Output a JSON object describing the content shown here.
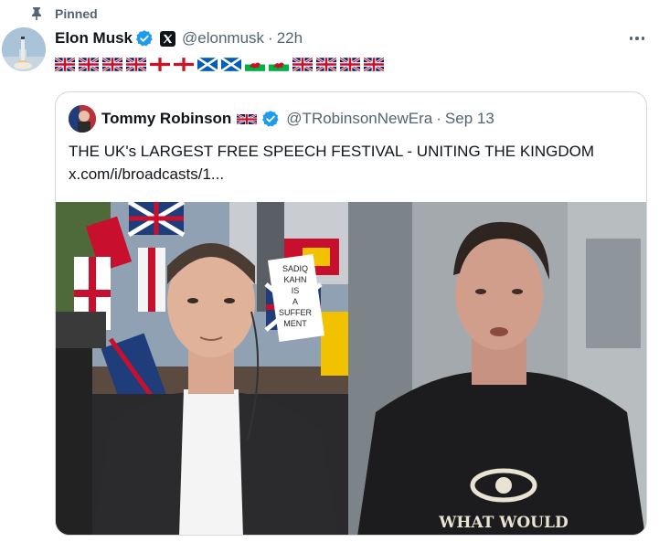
{
  "pinned": {
    "label": "Pinned"
  },
  "post": {
    "author_name": "Elon Musk",
    "handle": "@elonmusk",
    "separator": "·",
    "time": "22h",
    "flags": [
      "flag-uk",
      "flag-uk",
      "flag-uk",
      "flag-uk",
      "flag-england",
      "flag-england",
      "flag-scotland",
      "flag-scotland",
      "flag-wales",
      "flag-wales",
      "flag-uk",
      "flag-uk",
      "flag-uk",
      "flag-uk"
    ]
  },
  "quote": {
    "author_name": "Tommy Robinson",
    "handle": "@TRobinsonNewEra",
    "separator": "·",
    "date": "Sep 13",
    "text_line1": "THE UK's LARGEST FREE SPEECH FESTIVAL - UNITING THE KINGDOM",
    "text_line2": "x.com/i/broadcasts/1..."
  },
  "media": {
    "sign_text": [
      "SADIQ",
      "KAHN",
      "IS",
      "A",
      "SUFFER",
      "MENT"
    ],
    "shirt_text": "WHAT WOULD"
  },
  "colors": {
    "verified": "#1d9bf0",
    "secondary_text": "#536471",
    "border": "#cfd9de",
    "text": "#0f1419"
  },
  "icons": {
    "pin": "pin-icon",
    "verified": "verified-badge-icon",
    "x_affiliation": "x-logo-icon",
    "more": "more-options-icon"
  }
}
